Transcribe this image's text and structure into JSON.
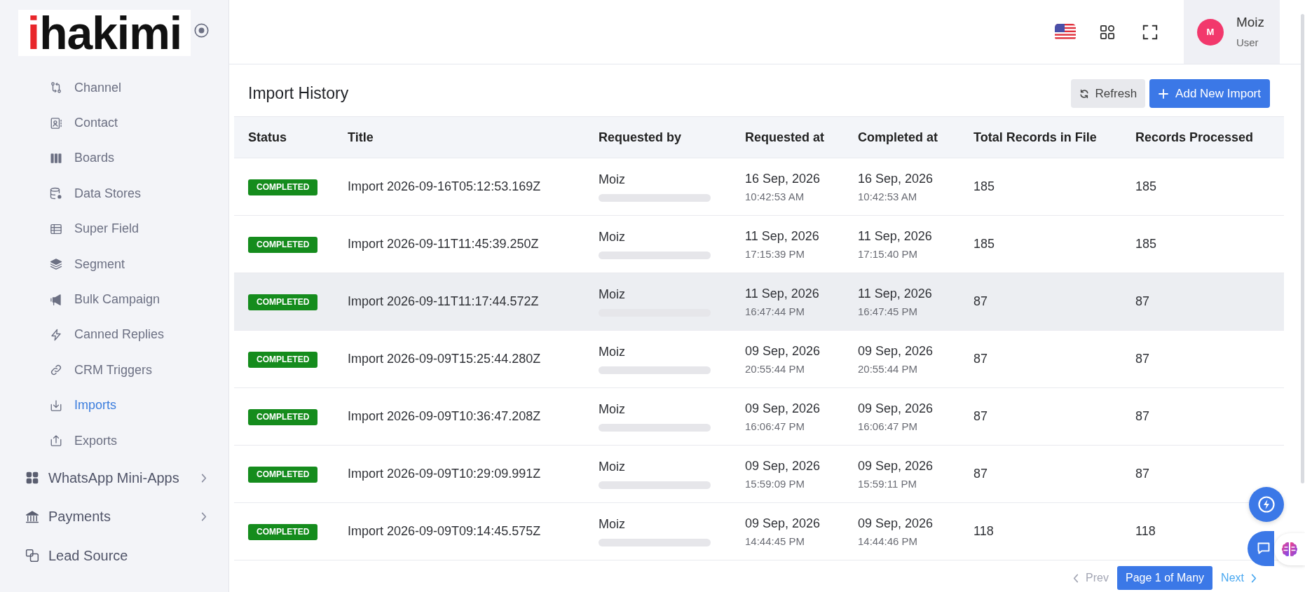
{
  "sidebar": {
    "logo": {
      "accent": "i",
      "text": "hakimi"
    },
    "sub_items": [
      {
        "label": "Channel",
        "selected": false
      },
      {
        "label": "Contact",
        "selected": false
      },
      {
        "label": "Boards",
        "selected": false
      },
      {
        "label": "Data Stores",
        "selected": false
      },
      {
        "label": "Super Field",
        "selected": false
      },
      {
        "label": "Segment",
        "selected": false
      },
      {
        "label": "Bulk Campaign",
        "selected": false
      },
      {
        "label": "Canned Replies",
        "selected": false
      },
      {
        "label": "CRM Triggers",
        "selected": false
      },
      {
        "label": "Imports",
        "selected": true
      },
      {
        "label": "Exports",
        "selected": false
      }
    ],
    "items": [
      {
        "label": "WhatsApp Mini-Apps",
        "kind": "group",
        "expanded": false,
        "selected": false
      },
      {
        "label": "Payments",
        "kind": "group",
        "expanded": false,
        "selected": false
      },
      {
        "label": "Lead Source",
        "kind": "link",
        "selected": false
      }
    ]
  },
  "header": {
    "user": {
      "initial": "M",
      "name": "Moiz",
      "role": "User"
    }
  },
  "content": {
    "title": "Import History",
    "actions": [
      {
        "label": "Refresh",
        "kind": "secondary"
      },
      {
        "label": "Add New Import",
        "kind": "primary"
      }
    ]
  },
  "table": {
    "columns": [
      "Status",
      "Title",
      "Requested by",
      "Requested at",
      "Completed at",
      "Total Records in File",
      "Records Processed"
    ],
    "rows": [
      {
        "status": {
          "label": "COMPLETED",
          "kind": "completed"
        },
        "title": "Import 2026-09-16T05:12:53.169Z",
        "requested_by": "Moiz",
        "requested_at": {
          "date": "16 Sep, 2026",
          "time": "10:42:53 AM"
        },
        "completed_at": {
          "date": "16 Sep, 2026",
          "time": "10:42:53 AM"
        },
        "total_records": "185",
        "records_processed": "185",
        "highlighted": false
      },
      {
        "status": {
          "label": "COMPLETED",
          "kind": "completed"
        },
        "title": "Import 2026-09-11T11:45:39.250Z",
        "requested_by": "Moiz",
        "requested_at": {
          "date": "11 Sep, 2026",
          "time": "17:15:39 PM"
        },
        "completed_at": {
          "date": "11 Sep, 2026",
          "time": "17:15:40 PM"
        },
        "total_records": "185",
        "records_processed": "185",
        "highlighted": false
      },
      {
        "status": {
          "label": "COMPLETED",
          "kind": "completed"
        },
        "title": "Import 2026-09-11T11:17:44.572Z",
        "requested_by": "Moiz",
        "requested_at": {
          "date": "11 Sep, 2026",
          "time": "16:47:44 PM"
        },
        "completed_at": {
          "date": "11 Sep, 2026",
          "time": "16:47:45 PM"
        },
        "total_records": "87",
        "records_processed": "87",
        "highlighted": true
      },
      {
        "status": {
          "label": "COMPLETED",
          "kind": "completed"
        },
        "title": "Import 2026-09-09T15:25:44.280Z",
        "requested_by": "Moiz",
        "requested_at": {
          "date": "09 Sep, 2026",
          "time": "20:55:44 PM"
        },
        "completed_at": {
          "date": "09 Sep, 2026",
          "time": "20:55:44 PM"
        },
        "total_records": "87",
        "records_processed": "87",
        "highlighted": false
      },
      {
        "status": {
          "label": "COMPLETED",
          "kind": "completed"
        },
        "title": "Import 2026-09-09T10:36:47.208Z",
        "requested_by": "Moiz",
        "requested_at": {
          "date": "09 Sep, 2026",
          "time": "16:06:47 PM"
        },
        "completed_at": {
          "date": "09 Sep, 2026",
          "time": "16:06:47 PM"
        },
        "total_records": "87",
        "records_processed": "87",
        "highlighted": false
      },
      {
        "status": {
          "label": "COMPLETED",
          "kind": "completed"
        },
        "title": "Import 2026-09-09T10:29:09.991Z",
        "requested_by": "Moiz",
        "requested_at": {
          "date": "09 Sep, 2026",
          "time": "15:59:09 PM"
        },
        "completed_at": {
          "date": "09 Sep, 2026",
          "time": "15:59:11 PM"
        },
        "total_records": "87",
        "records_processed": "87",
        "highlighted": false
      },
      {
        "status": {
          "label": "COMPLETED",
          "kind": "completed"
        },
        "title": "Import 2026-09-09T09:14:45.575Z",
        "requested_by": "Moiz",
        "requested_at": {
          "date": "09 Sep, 2026",
          "time": "14:44:45 PM"
        },
        "completed_at": {
          "date": "09 Sep, 2026",
          "time": "14:44:46 PM"
        },
        "total_records": "118",
        "records_processed": "118",
        "highlighted": false
      }
    ]
  },
  "pagination": {
    "prev": {
      "label": "Prev",
      "disabled": true
    },
    "current": "Page 1 of Many",
    "next": {
      "label": "Next",
      "disabled": false
    }
  }
}
